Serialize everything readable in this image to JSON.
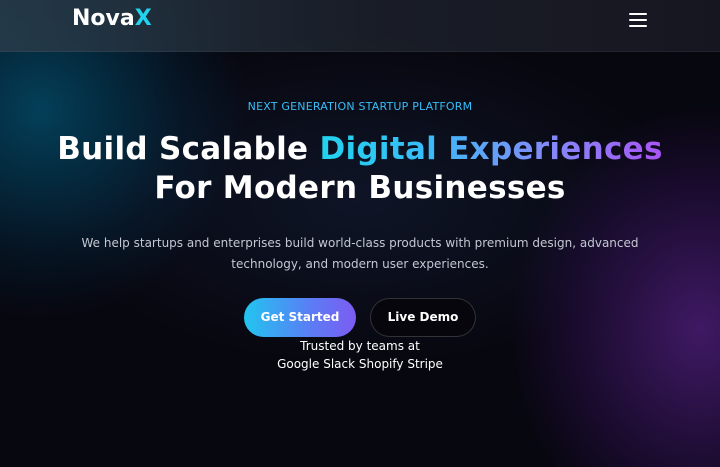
{
  "nav": {
    "logo_main": "Nova",
    "logo_accent": "X",
    "menu_icon": "hamburger-menu-icon"
  },
  "hero": {
    "eyebrow": "NEXT GENERATION STARTUP PLATFORM",
    "headline_part1": "Build Scalable ",
    "headline_highlight": "Digital Experiences",
    "headline_line2": "For Modern Businesses",
    "description_line1": "We help startups and enterprises build world-class products with premium design, advanced",
    "description_line2": "technology, and modern user experiences.",
    "primary_cta": "Get Started",
    "secondary_cta": "Live Demo",
    "trusted_label": "Trusted by teams at",
    "trusted_brands": "Google Slack Shopify Stripe"
  },
  "colors": {
    "accent_cyan": "#22d3ee",
    "accent_purple": "#a855f7",
    "eyebrow": "#38bdf8",
    "background": "#07070f"
  }
}
